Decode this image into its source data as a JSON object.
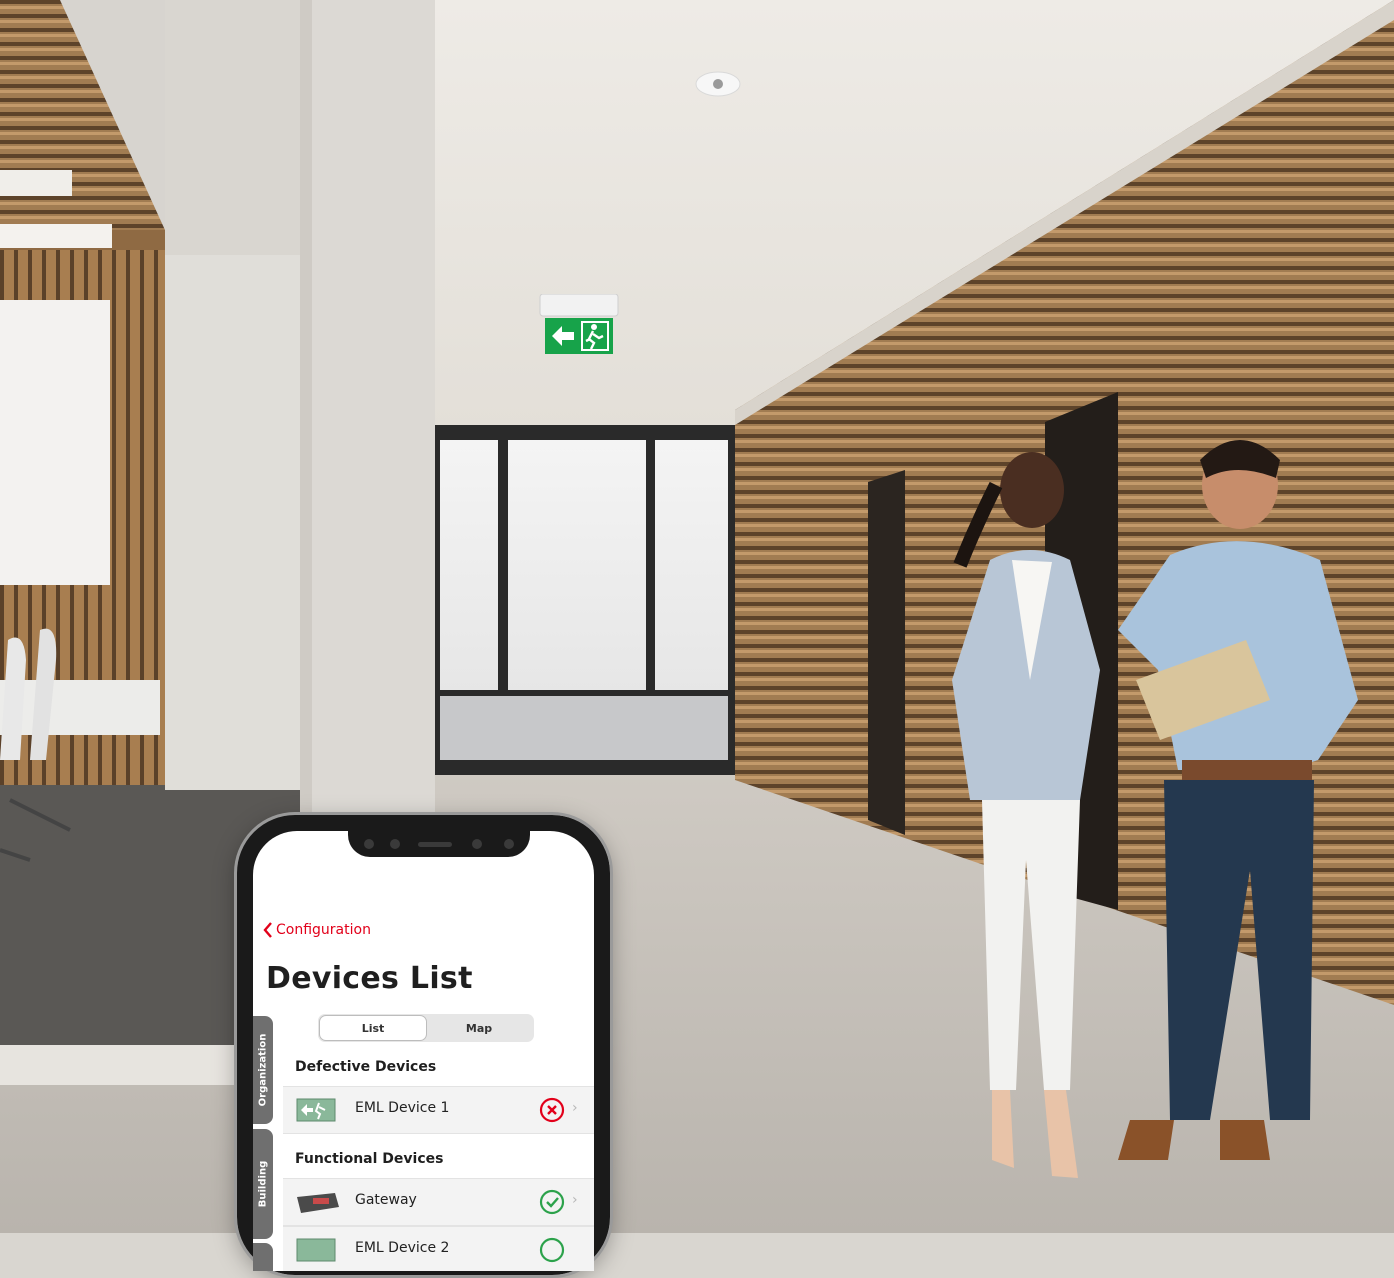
{
  "phone": {
    "back_label": "Configuration",
    "title": "Devices List",
    "side_tabs": [
      "Organization",
      "Building"
    ],
    "segments": {
      "list": "List",
      "map": "Map",
      "active": "List"
    },
    "sections": [
      {
        "heading": "Defective Devices",
        "devices": [
          {
            "name": "EML Device 1",
            "status": "error",
            "icon": "exit-sign-icon"
          }
        ]
      },
      {
        "heading": "Functional Devices",
        "devices": [
          {
            "name": "Gateway",
            "status": "ok",
            "icon": "gateway-icon"
          },
          {
            "name": "EML Device 2",
            "status": "ok",
            "icon": "exit-sign-icon"
          }
        ]
      }
    ],
    "colors": {
      "accent": "#e2001a",
      "ok": "#2ca24b",
      "error": "#e2001a"
    }
  },
  "scene": {
    "exit_sign_icon": "running-man-arrow-icon"
  }
}
